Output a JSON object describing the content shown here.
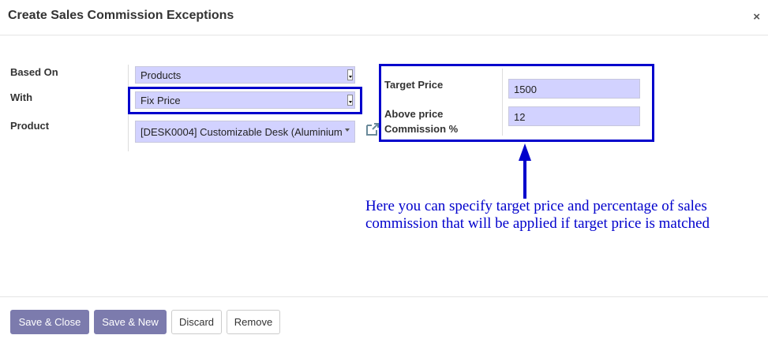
{
  "dialog": {
    "title": "Create Sales Commission Exceptions",
    "close_glyph": "×"
  },
  "form": {
    "based_on_label": "Based On",
    "based_on_value": "Products",
    "with_label": "With",
    "with_value": "Fix Price",
    "product_label": "Product",
    "product_value": "[DESK0004] Customizable Desk (Aluminium",
    "target_price_label": "Target Price",
    "target_price_value": "1500",
    "above_price_label_line1": "Above price",
    "above_price_label_line2": "Commission %",
    "above_price_value": "12"
  },
  "annotation": {
    "note": "Here you can specify target price and percentage of sales commission that will be applied if target price is matched",
    "color": "#0000cc"
  },
  "footer": {
    "save_close": "Save & Close",
    "save_new": "Save & New",
    "discard": "Discard",
    "remove": "Remove"
  },
  "colors": {
    "primary_button": "#7c7bad",
    "field_background": "#d2d2ff"
  },
  "icons": {
    "external_link": "external-link-icon",
    "close": "close-icon"
  }
}
